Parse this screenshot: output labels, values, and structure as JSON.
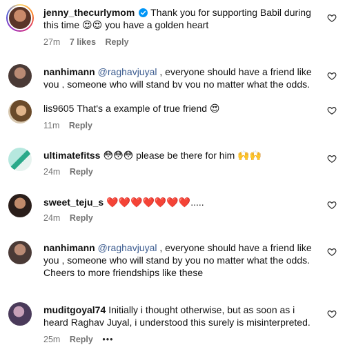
{
  "comments": [
    {
      "username": "jenny_thecurlymom",
      "verified": true,
      "text": "Thank you for supporting Babil during this time 😍😍 you have a golden heart",
      "time": "27m",
      "likes": "7 likes",
      "reply": "Reply"
    },
    {
      "username": "nanhimann",
      "mention": "@raghavjuyal",
      "text": ", everyone should have a friend like you , someone who will stand by you no matter what the odds."
    },
    {
      "username": "lis9605",
      "text": "That's a example of true friend 😍",
      "time": "11m",
      "reply": "Reply"
    },
    {
      "username": "ultimatefitss",
      "text": "😳😳😳 please be there for him 🙌🙌",
      "time": "24m",
      "reply": "Reply"
    },
    {
      "username": "sweet_teju_s",
      "text": "❤️❤️❤️❤️❤️❤️❤️.....",
      "time": "24m",
      "reply": "Reply"
    },
    {
      "username": "nanhimann",
      "mention": "@raghavjuyal",
      "text": ", everyone should have a friend like you , someone who will stand by you no matter what the odds. Cheers to more friendships like these"
    },
    {
      "username": "muditgoyal74",
      "text": "Initially i thought otherwise, but as soon as i heard Raghav Juyal, i understood this surely is misinterpreted.",
      "time": "25m",
      "reply": "Reply",
      "more": "•••"
    }
  ],
  "icons": {
    "heart": "heart-outline-icon",
    "verified": "verified-badge-icon"
  },
  "colors": {
    "mention": "#3b5b8f",
    "meta": "#737373",
    "verified": "#0095f6"
  }
}
